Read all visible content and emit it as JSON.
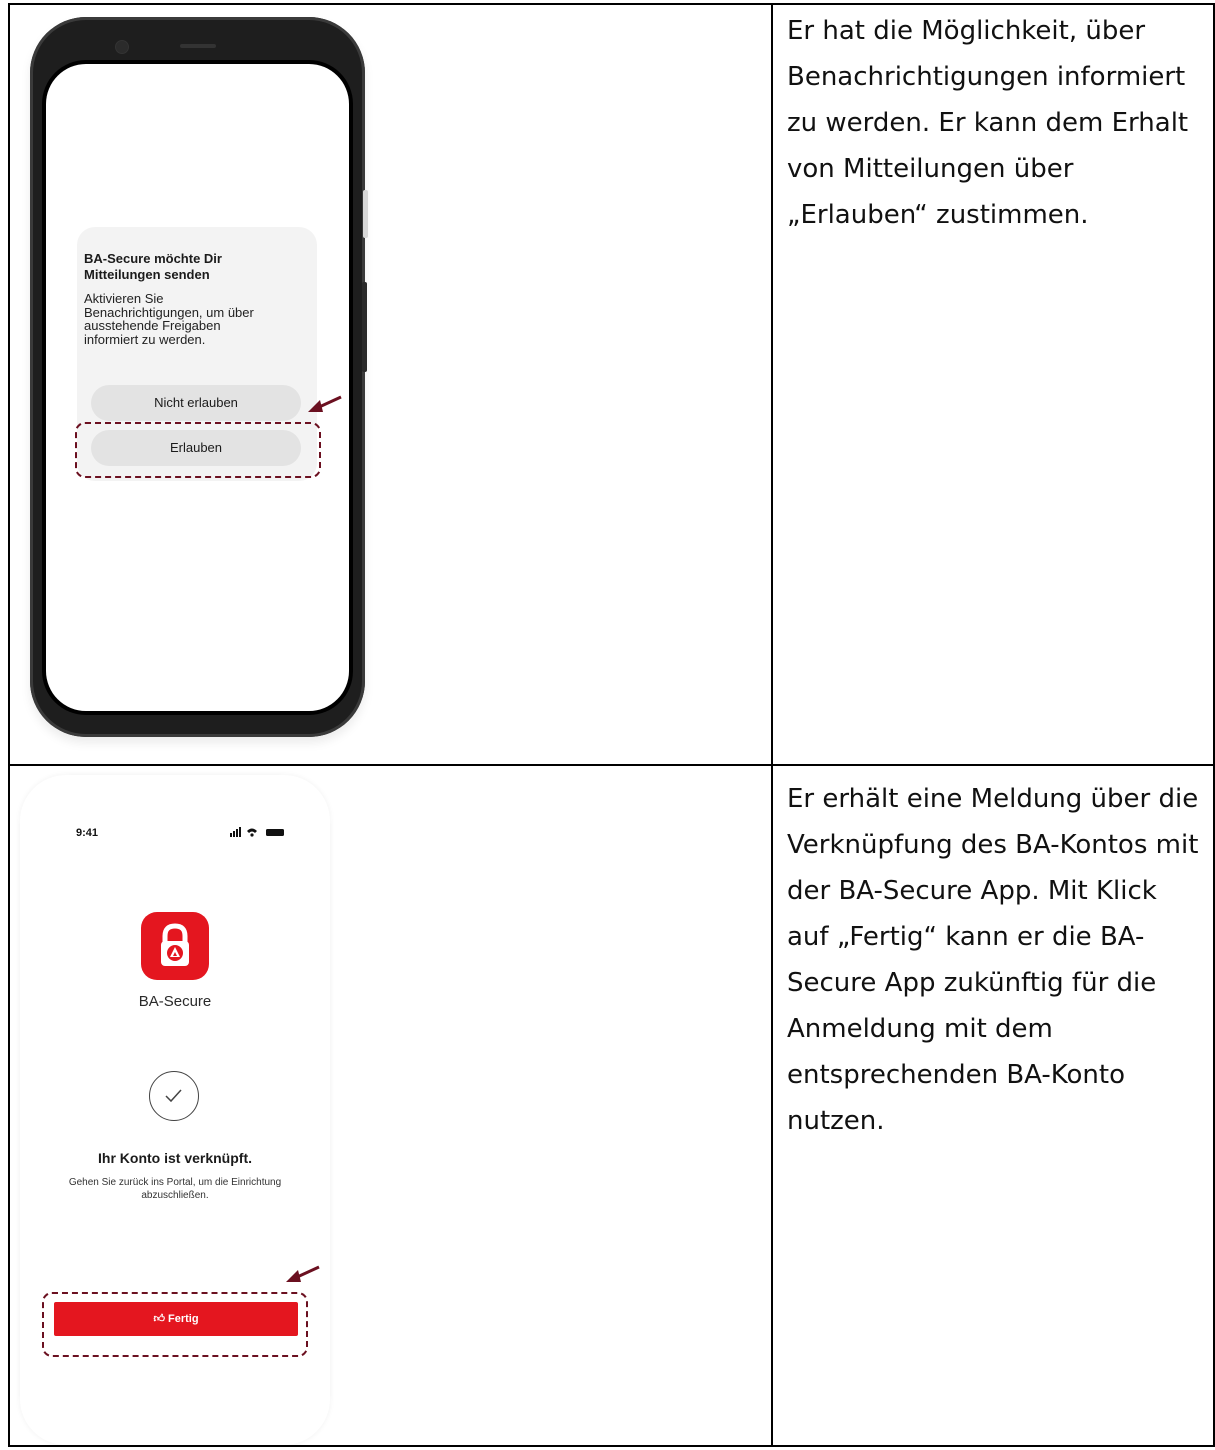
{
  "row1": {
    "dialog": {
      "title": "BA-Secure möchte Dir\nMitteilungen senden",
      "body": "Aktivieren Sie\nBenachrichtigungen, um über\nausstehende Freigaben\ninformiert zu werden.",
      "deny_label": "Nicht erlauben",
      "allow_label": "Erlauben"
    },
    "description": "Er hat die Möglichkeit, über\nBenachrichtigungen informiert\nzu werden. Er kann dem Erhalt\nvon Mitteilungen über\n„Erlauben“ zustimmen."
  },
  "row2": {
    "status_time": "9:41",
    "app_name": "BA-Secure",
    "success_title": "Ihr Konto ist verknüpft.",
    "success_subtitle": "Gehen Sie zurück ins Portal, um die Einrichtung\nabzuschließen.",
    "done_label": "Fertig",
    "description": "Er erhält eine Meldung über die\nVerknüpfung des BA-Kontos mit\nder BA-Secure App. Mit Klick\nauf „Fertig“ kann er die BA-\nSecure App zukünftig für die\nAnmeldung mit dem\nentsprechenden BA-Konto\nnutzen."
  },
  "colors": {
    "accent_red": "#e4161f",
    "highlight": "#6b1020"
  }
}
